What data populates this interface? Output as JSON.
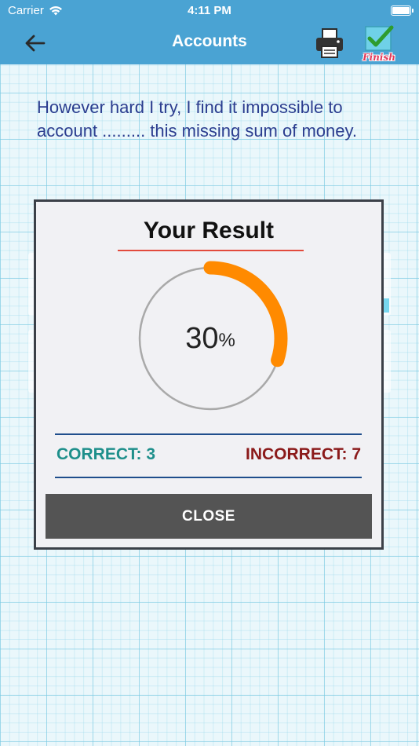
{
  "status_bar": {
    "carrier": "Carrier",
    "time": "4:11 PM"
  },
  "nav": {
    "title": "Accounts",
    "finish_label": "Finish"
  },
  "question": {
    "text": "However hard I try, I find it impossible to account ......... this missing sum of money."
  },
  "result": {
    "title": "Your Result",
    "percent_value": "30",
    "percent_sign": "%",
    "progress_fraction": 0.3,
    "correct_label": "CORRECT: 3",
    "incorrect_label": "INCORRECT: 7",
    "close_label": "CLOSE"
  },
  "colors": {
    "header": "#4aa3d3",
    "accent_orange": "#ff8a00",
    "correct": "#1e8f8b",
    "incorrect": "#8b1a1a",
    "close_button": "#545454",
    "title_underline": "#e24a3c",
    "question_text": "#2b3d8f"
  },
  "icons": [
    "wifi-icon",
    "battery-icon",
    "back-arrow-icon",
    "printer-icon",
    "finish-check-icon"
  ]
}
